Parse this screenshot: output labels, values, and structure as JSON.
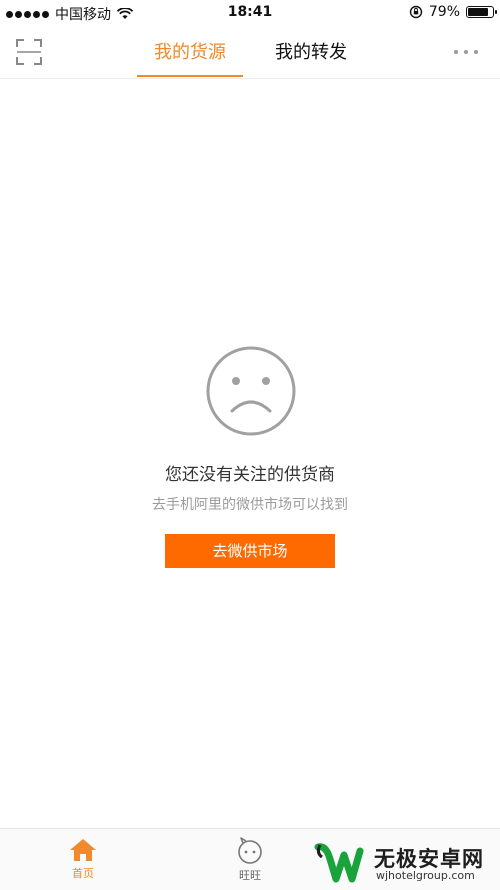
{
  "status_bar": {
    "carrier": "中国移动",
    "time": "18:41",
    "battery": "79%"
  },
  "header": {
    "tabs": [
      {
        "label": "我的货源",
        "active": true
      },
      {
        "label": "我的转发",
        "active": false
      }
    ],
    "accent_color": "#f08a2a"
  },
  "empty_state": {
    "title": "您还没有关注的供货商",
    "subtitle": "去手机阿里的微供市场可以找到",
    "button_label": "去微供市场",
    "button_color": "#ff6a00"
  },
  "bottom_nav": {
    "items": [
      {
        "label": "首页",
        "icon": "home-icon",
        "active": true
      },
      {
        "label": "旺旺",
        "icon": "wangwang-icon",
        "active": false
      }
    ]
  },
  "watermark": {
    "name": "无极安卓网",
    "url": "wjhotelgroup.com"
  }
}
